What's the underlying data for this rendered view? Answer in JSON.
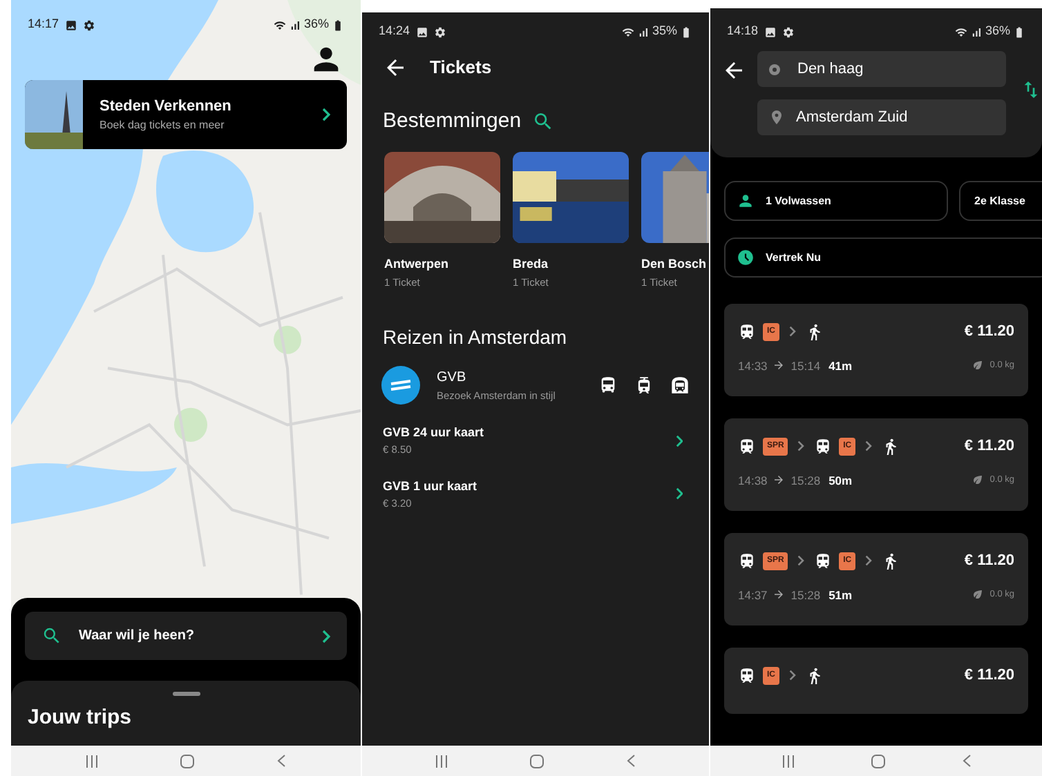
{
  "map_screen": {
    "status_bar": {
      "time": "14:17",
      "battery": "36%"
    },
    "promo": {
      "title": "Steden Verkennen",
      "subtitle": "Boek dag tickets en meer"
    },
    "search": {
      "placeholder": "Waar wil je heen?"
    },
    "sheet": {
      "title": "Jouw trips"
    }
  },
  "tickets_screen": {
    "status_bar": {
      "time": "14:24",
      "battery": "35%"
    },
    "title": "Tickets",
    "destinations": {
      "title": "Bestemmingen",
      "items": [
        {
          "name": "Antwerpen",
          "count": "1 Ticket",
          "kind": "station"
        },
        {
          "name": "Breda",
          "count": "1 Ticket",
          "kind": "canal"
        },
        {
          "name": "Den Bosch",
          "count": "1 Ticket",
          "kind": "church"
        }
      ]
    },
    "city": {
      "title": "Reizen in Amsterdam",
      "provider": {
        "name": "GVB",
        "subtitle": "Bezoek Amsterdam in stijl"
      },
      "products": [
        {
          "name": "GVB 24 uur kaart",
          "price": "€ 8.50"
        },
        {
          "name": "GVB 1 uur kaart",
          "price": "€ 3.20"
        }
      ]
    }
  },
  "planner_screen": {
    "status_bar": {
      "time": "14:18",
      "battery": "36%"
    },
    "from": "Den haag",
    "to": "Amsterdam Zuid",
    "passengers": "1 Volwassen",
    "class": "2e Klasse",
    "departure": "Vertrek Nu",
    "journeys": [
      {
        "legs": [
          {
            "kind": "train",
            "badge": "IC"
          },
          {
            "kind": "walk"
          }
        ],
        "price": "€ 11.20",
        "depart": "14:33",
        "arrive": "15:14",
        "duration": "41m",
        "co2": "0.0 kg"
      },
      {
        "legs": [
          {
            "kind": "train",
            "badge": "SPR"
          },
          {
            "kind": "train",
            "badge": "IC"
          },
          {
            "kind": "walk"
          }
        ],
        "price": "€ 11.20",
        "depart": "14:38",
        "arrive": "15:28",
        "duration": "50m",
        "co2": "0.0 kg"
      },
      {
        "legs": [
          {
            "kind": "train",
            "badge": "SPR"
          },
          {
            "kind": "train",
            "badge": "IC"
          },
          {
            "kind": "walk"
          }
        ],
        "price": "€ 11.20",
        "depart": "14:37",
        "arrive": "15:28",
        "duration": "51m",
        "co2": "0.0 kg"
      },
      {
        "legs": [
          {
            "kind": "train",
            "badge": "IC"
          },
          {
            "kind": "walk"
          }
        ],
        "price": "€ 11.20"
      }
    ]
  }
}
